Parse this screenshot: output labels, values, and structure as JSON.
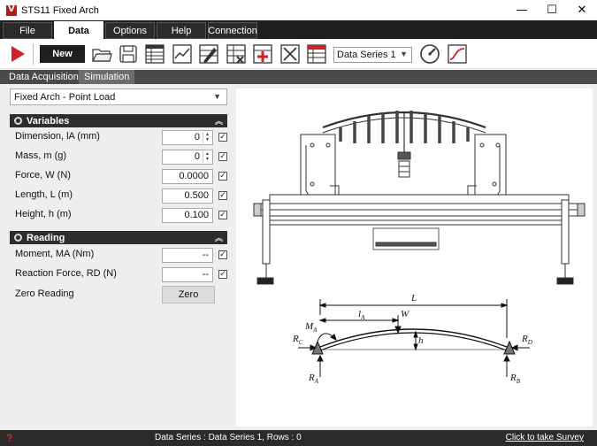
{
  "window": {
    "title": "STS11 Fixed Arch",
    "minimize": "—",
    "maximize": "☐",
    "close": "✕"
  },
  "menu": {
    "items": [
      "File",
      "Data",
      "Options",
      "Help",
      "Connection"
    ],
    "active": "Data"
  },
  "toolbar": {
    "new_label": "New",
    "series_value": "Data Series 1",
    "icons": [
      "play-icon",
      "open-folder-icon",
      "save-icon",
      "table-icon",
      "line-graph-icon",
      "edit-table-icon",
      "delete-row-icon",
      "add-row-icon",
      "clear-table-icon",
      "table-settings-icon",
      "gauge-icon",
      "curve-icon"
    ]
  },
  "subtabs": {
    "items": [
      "Data Acquisition",
      "Simulation"
    ],
    "active": "Simulation"
  },
  "mode": {
    "value": "Fixed Arch - Point Load"
  },
  "variables": {
    "title": "Variables",
    "rows": [
      {
        "label": "Dimension, lA (mm)",
        "value": "0",
        "spinner": true,
        "checked": true
      },
      {
        "label": "Mass, m (g)",
        "value": "0",
        "spinner": true,
        "checked": true
      },
      {
        "label": "Force, W (N)",
        "value": "0.0000",
        "spinner": false,
        "checked": true
      },
      {
        "label": "Length, L (m)",
        "value": "0.500",
        "spinner": false,
        "checked": true
      },
      {
        "label": "Height, h (m)",
        "value": "0.100",
        "spinner": false,
        "checked": true
      }
    ]
  },
  "reading": {
    "title": "Reading",
    "rows": [
      {
        "label": "Moment, MA (Nm)",
        "value": "--",
        "checked": true
      },
      {
        "label": "Reaction Force, RD (N)",
        "value": "--",
        "checked": true
      }
    ],
    "zero_label": "Zero Reading",
    "zero_button": "Zero"
  },
  "diagram": {
    "L": "L",
    "lA": "l",
    "lA_sub": "A",
    "W": "W",
    "MA": "M",
    "MA_sub": "A",
    "h": "h",
    "RC": "R",
    "RC_sub": "C",
    "RD": "R",
    "RD_sub": "D",
    "RA": "R",
    "RA_sub": "A",
    "RB": "R",
    "RB_sub": "B"
  },
  "statusbar": {
    "help": "?",
    "status": "Data Series : Data Series 1,  Rows : 0",
    "survey": "Click to take Survey"
  },
  "colors": {
    "accent_red": "#d0202a",
    "dark_bar": "#1f1f1f"
  }
}
